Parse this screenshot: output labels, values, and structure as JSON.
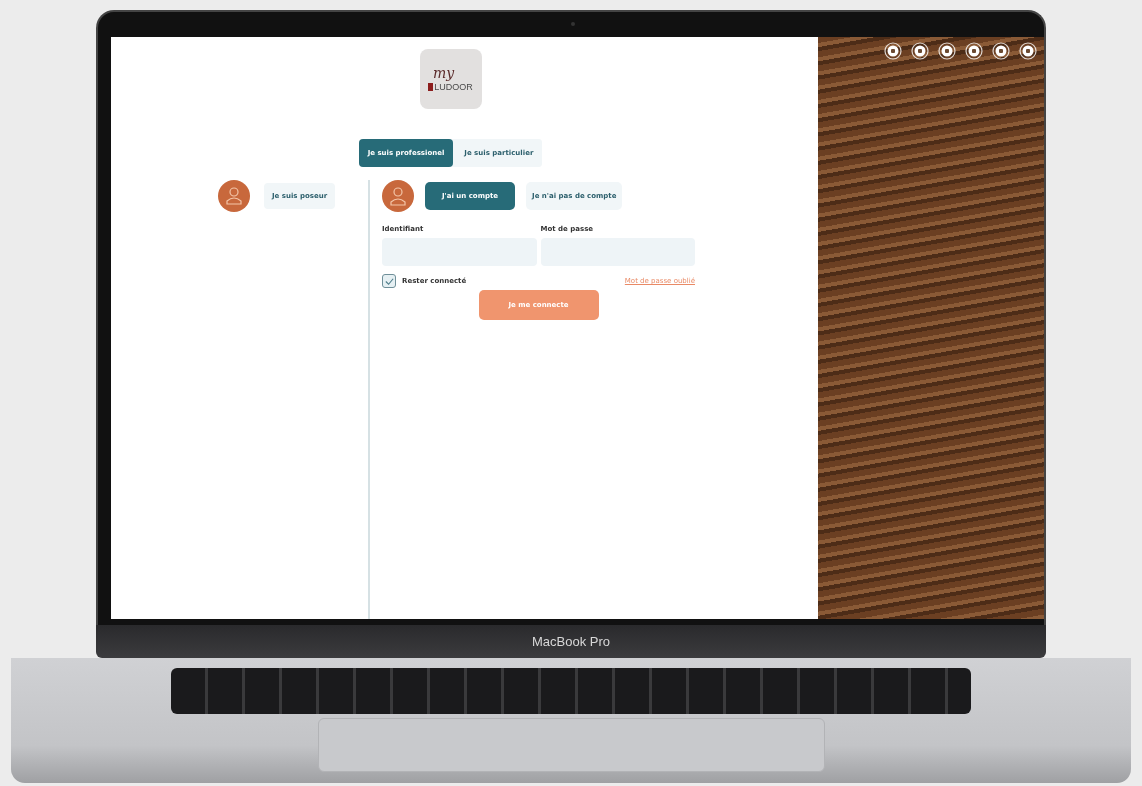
{
  "logo": {
    "script": "my",
    "name": "LUDOOR"
  },
  "profile_tabs": [
    {
      "label": "Je suis professionel",
      "selected": true
    },
    {
      "label": "Je suis particulier",
      "selected": false
    }
  ],
  "roles": [
    {
      "label": "Je suis poseur"
    }
  ],
  "account_tabs": [
    {
      "label": "J'ai un compte",
      "selected": true
    },
    {
      "label": "Je n'ai pas de compte",
      "selected": false
    }
  ],
  "fields": [
    {
      "label": "Identifiant"
    },
    {
      "label": "Mot de passe"
    }
  ],
  "remember": {
    "label": "Rester connecté",
    "checked": true
  },
  "forgot_link": "Mot de passe oublié",
  "submit": "Je me connecte",
  "device_label": "MacBook Pro"
}
